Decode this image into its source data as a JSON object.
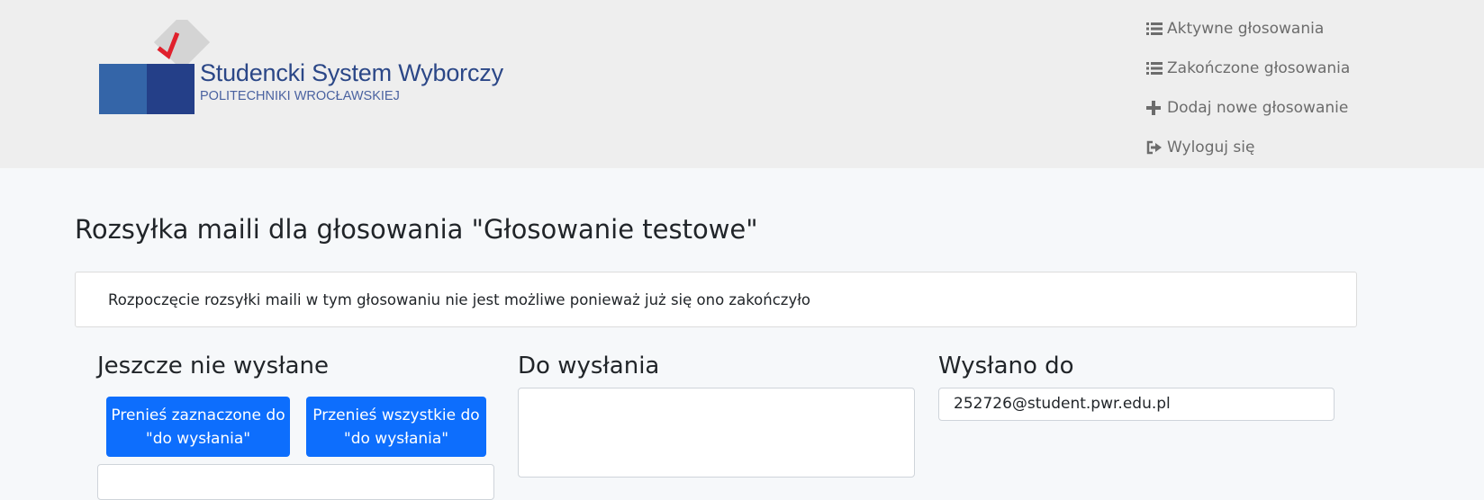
{
  "logo": {
    "title": "Studencki System Wyborczy",
    "subtitle": "POLITECHNIKI WROCŁAWSKIEJ",
    "colors": {
      "box_left": "#3465a8",
      "box_right": "#243f88",
      "ballot": "#d4d4d4",
      "check": "#e0202c"
    }
  },
  "nav": {
    "items": [
      {
        "icon": "list-icon",
        "label": "Aktywne głosowania"
      },
      {
        "icon": "list-icon",
        "label": "Zakończone głosowania"
      },
      {
        "icon": "plus-icon",
        "label": "Dodaj nowe głosowanie"
      },
      {
        "icon": "sign-out-icon",
        "label": "Wyloguj się"
      }
    ]
  },
  "page": {
    "title": "Rozsyłka maili dla głosowania \"Głosowanie testowe\"",
    "alert": "Rozpoczęcie rozsyłki maili w tym głosowaniu nie jest możliwe ponieważ już się ono zakończyło"
  },
  "columns": {
    "not_sent": {
      "title": "Jeszcze nie wysłane",
      "move_selected_label": "Prenieś zaznaczone do \"do wysłania\"",
      "move_all_label": "Przenieś wszystkie do \"do wysłania\""
    },
    "to_send": {
      "title": "Do wysłania"
    },
    "sent": {
      "title": "Wysłano do",
      "emails": [
        "252726@student.pwr.edu.pl"
      ]
    }
  },
  "colors": {
    "primary": "#0d6efd",
    "header_bg": "#eeeeee",
    "page_bg": "#f6f8fa"
  }
}
